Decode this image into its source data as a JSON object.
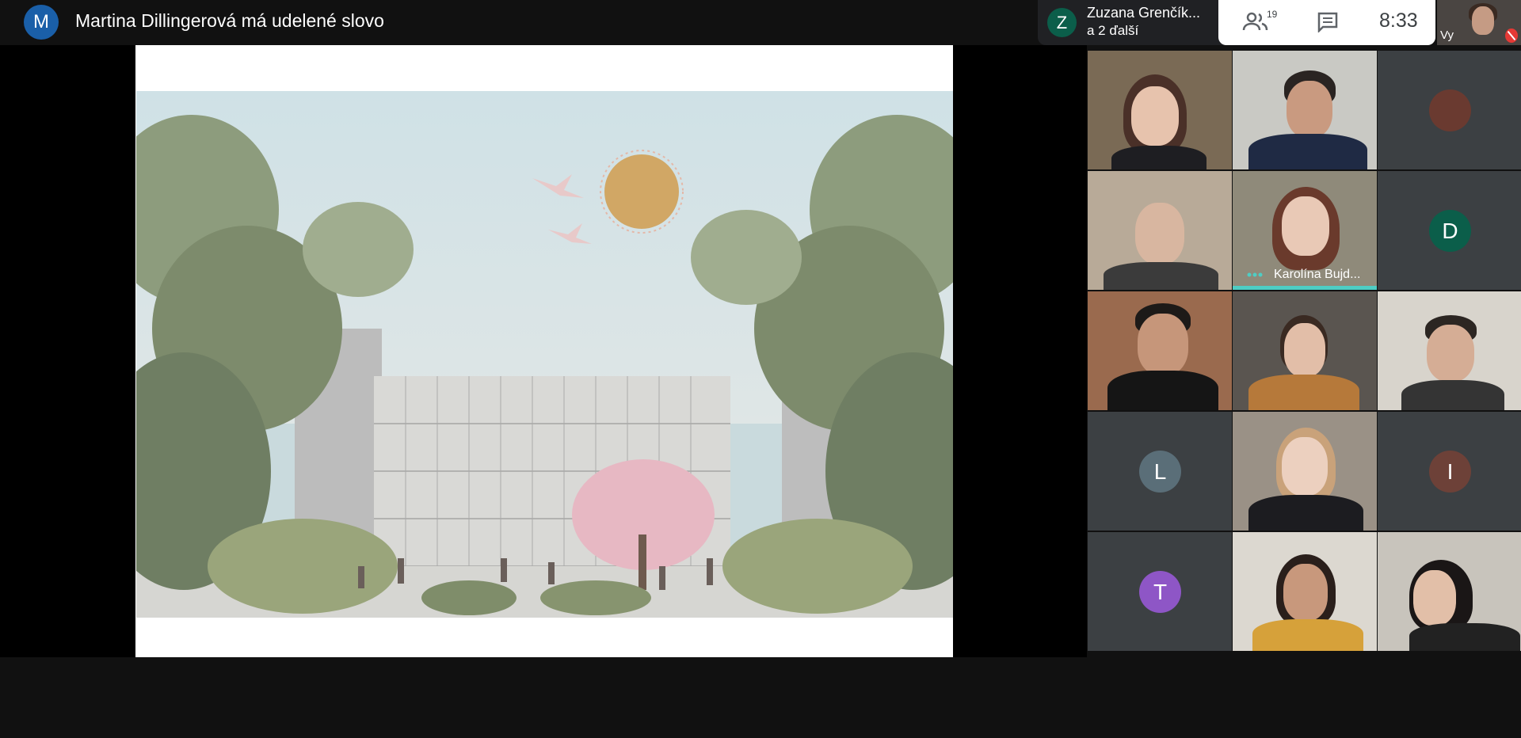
{
  "meeting": {
    "presenter_initial": "M",
    "presenter_title": "Martina Dillingerová má udelené slovo"
  },
  "speakers": {
    "initial": "Z",
    "name": "Zuzana Grenčík...",
    "more": "a 2 ďalší"
  },
  "controls": {
    "people_icon": "people-icon",
    "participant_count": "19",
    "chat_icon": "chat-icon",
    "time": "8:33"
  },
  "self_view": {
    "label": "Vy",
    "mic_status": "muted"
  },
  "colors": {
    "accent_speaking": "#4ecdc4",
    "avatar_M": "#1a5fa8",
    "avatar_Z": "#0b5e4a",
    "avatar_D": "#0b5e4a",
    "avatar_L": "#5a6e78",
    "avatar_I": "#6d4138",
    "avatar_T": "#8e56c6",
    "mic_off": "#e53935"
  },
  "tiles": {
    "t_avatar_photo": "",
    "active_speaker_label": "Karolína Bujd...",
    "avatar_D": "D",
    "avatar_L": "L",
    "avatar_I": "I",
    "avatar_T": "T"
  }
}
